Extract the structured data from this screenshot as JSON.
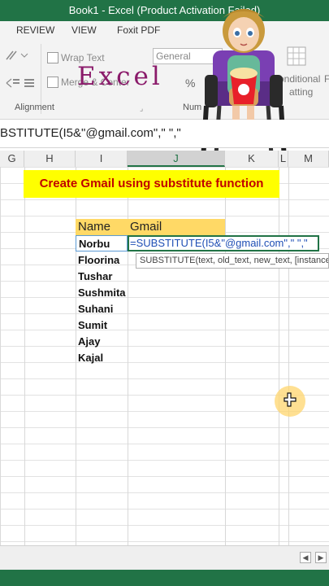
{
  "window": {
    "title": "Book1 -  Excel (Product Activation Failed)"
  },
  "ribbon_tabs": [
    "REVIEW",
    "VIEW",
    "Foxit PDF"
  ],
  "ribbon": {
    "wrap_text": "Wrap Text",
    "merge_center": "Merge & Center",
    "number_format": "General",
    "percent": "%",
    "group_alignment": "Alignment",
    "group_number": "Num",
    "conditional": "onditional",
    "formatting": "atting",
    "cut_p": "F"
  },
  "overlay_text": "Excel",
  "formula_bar": {
    "text": "BSTITUTE(I5&\"@gmail.com\",\" \",\""
  },
  "columns": [
    {
      "label": "G",
      "selected": false
    },
    {
      "label": "H",
      "selected": false
    },
    {
      "label": "I",
      "selected": false
    },
    {
      "label": "J",
      "selected": true
    },
    {
      "label": "K",
      "selected": false
    },
    {
      "label": "L",
      "selected": false
    },
    {
      "label": "M",
      "selected": false
    }
  ],
  "sheet": {
    "banner": "Create Gmail using substitute function",
    "header_name": "Name",
    "header_gmail": "Gmail",
    "names": [
      "Norbu",
      "Floorina",
      "Tushar",
      "Sushmita",
      "Suhani",
      "Sumit",
      "Ajay",
      "Kajal"
    ],
    "edit_formula": "=SUBSTITUTE(I5&\"@gmail.com\",\" \",\"",
    "tooltip": "SUBSTITUTE(text, old_text, new_text, [instance_num])"
  },
  "sheetbar": {
    "scroll_left": "◀",
    "scroll_right": "▶"
  },
  "colors": {
    "excel_green": "#217346",
    "banner_yellow": "#ffff00",
    "banner_text": "#c00000",
    "header_fill": "#ffd966",
    "formula_blue": "#1f4fb5"
  },
  "icons": [
    "pointer-cursor-icon",
    "cartoon-character-icon"
  ]
}
